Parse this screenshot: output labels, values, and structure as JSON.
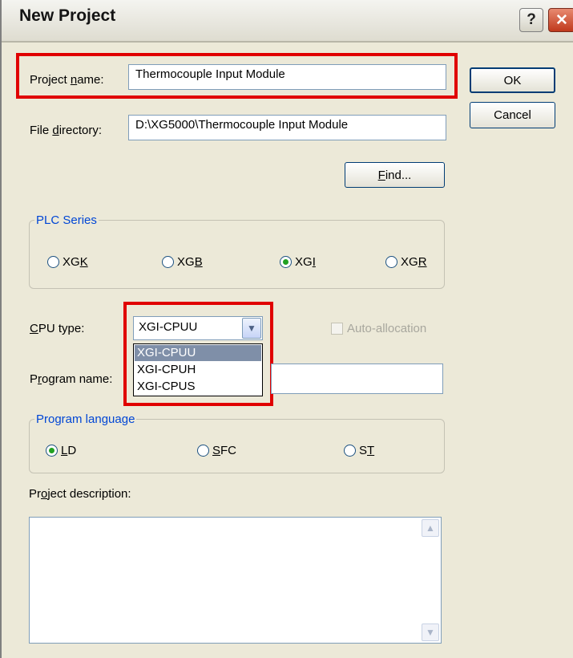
{
  "dialog": {
    "title": "New Project",
    "help_glyph": "?",
    "close_glyph": "✕"
  },
  "project_name": {
    "label_pre": "Project ",
    "label_key": "n",
    "label_post": "ame:",
    "value": "Thermocouple Input Module"
  },
  "file_directory": {
    "label_pre": "File ",
    "label_key": "d",
    "label_post": "irectory:",
    "value": "D:\\XG5000\\Thermocouple Input Module"
  },
  "buttons": {
    "ok": "OK",
    "cancel": "Cancel",
    "find_key": "F",
    "find_rest": "ind..."
  },
  "plc_series": {
    "legend": "PLC Series",
    "options": [
      {
        "pre": "XG",
        "key": "K",
        "selected": false
      },
      {
        "pre": "XG",
        "key": "B",
        "selected": false
      },
      {
        "pre": "XG",
        "key": "I",
        "selected": true
      },
      {
        "pre": "XG",
        "key": "R",
        "selected": false
      }
    ]
  },
  "cpu_type": {
    "label_key": "C",
    "label_rest": "PU type:",
    "value": "XGI-CPUU",
    "options": [
      "XGI-CPUU",
      "XGI-CPUH",
      "XGI-CPUS"
    ],
    "highlighted": "XGI-CPUU"
  },
  "auto_allocation": {
    "label": "Auto-allocation",
    "checked": false,
    "enabled": false
  },
  "program_name": {
    "label_pre": "P",
    "label_key": "r",
    "label_post": "ogram name:",
    "value": ""
  },
  "program_language": {
    "legend": "Program language",
    "options": [
      {
        "key": "L",
        "rest": "D",
        "selected": true
      },
      {
        "key": "S",
        "rest": "FC",
        "pre": "",
        "selected": false
      },
      {
        "pre": "S",
        "key": "T",
        "rest": "",
        "selected": false
      }
    ]
  },
  "project_description": {
    "label_pre": "Pr",
    "label_key": "o",
    "label_post": "ject description:",
    "value": ""
  },
  "icons": {
    "help": "question-icon",
    "close": "close-icon",
    "dropdown": "chevron-down-icon"
  },
  "colors": {
    "highlight_red": "#e00000",
    "legend_blue": "#0046d5",
    "radio_green": "#21a121"
  }
}
